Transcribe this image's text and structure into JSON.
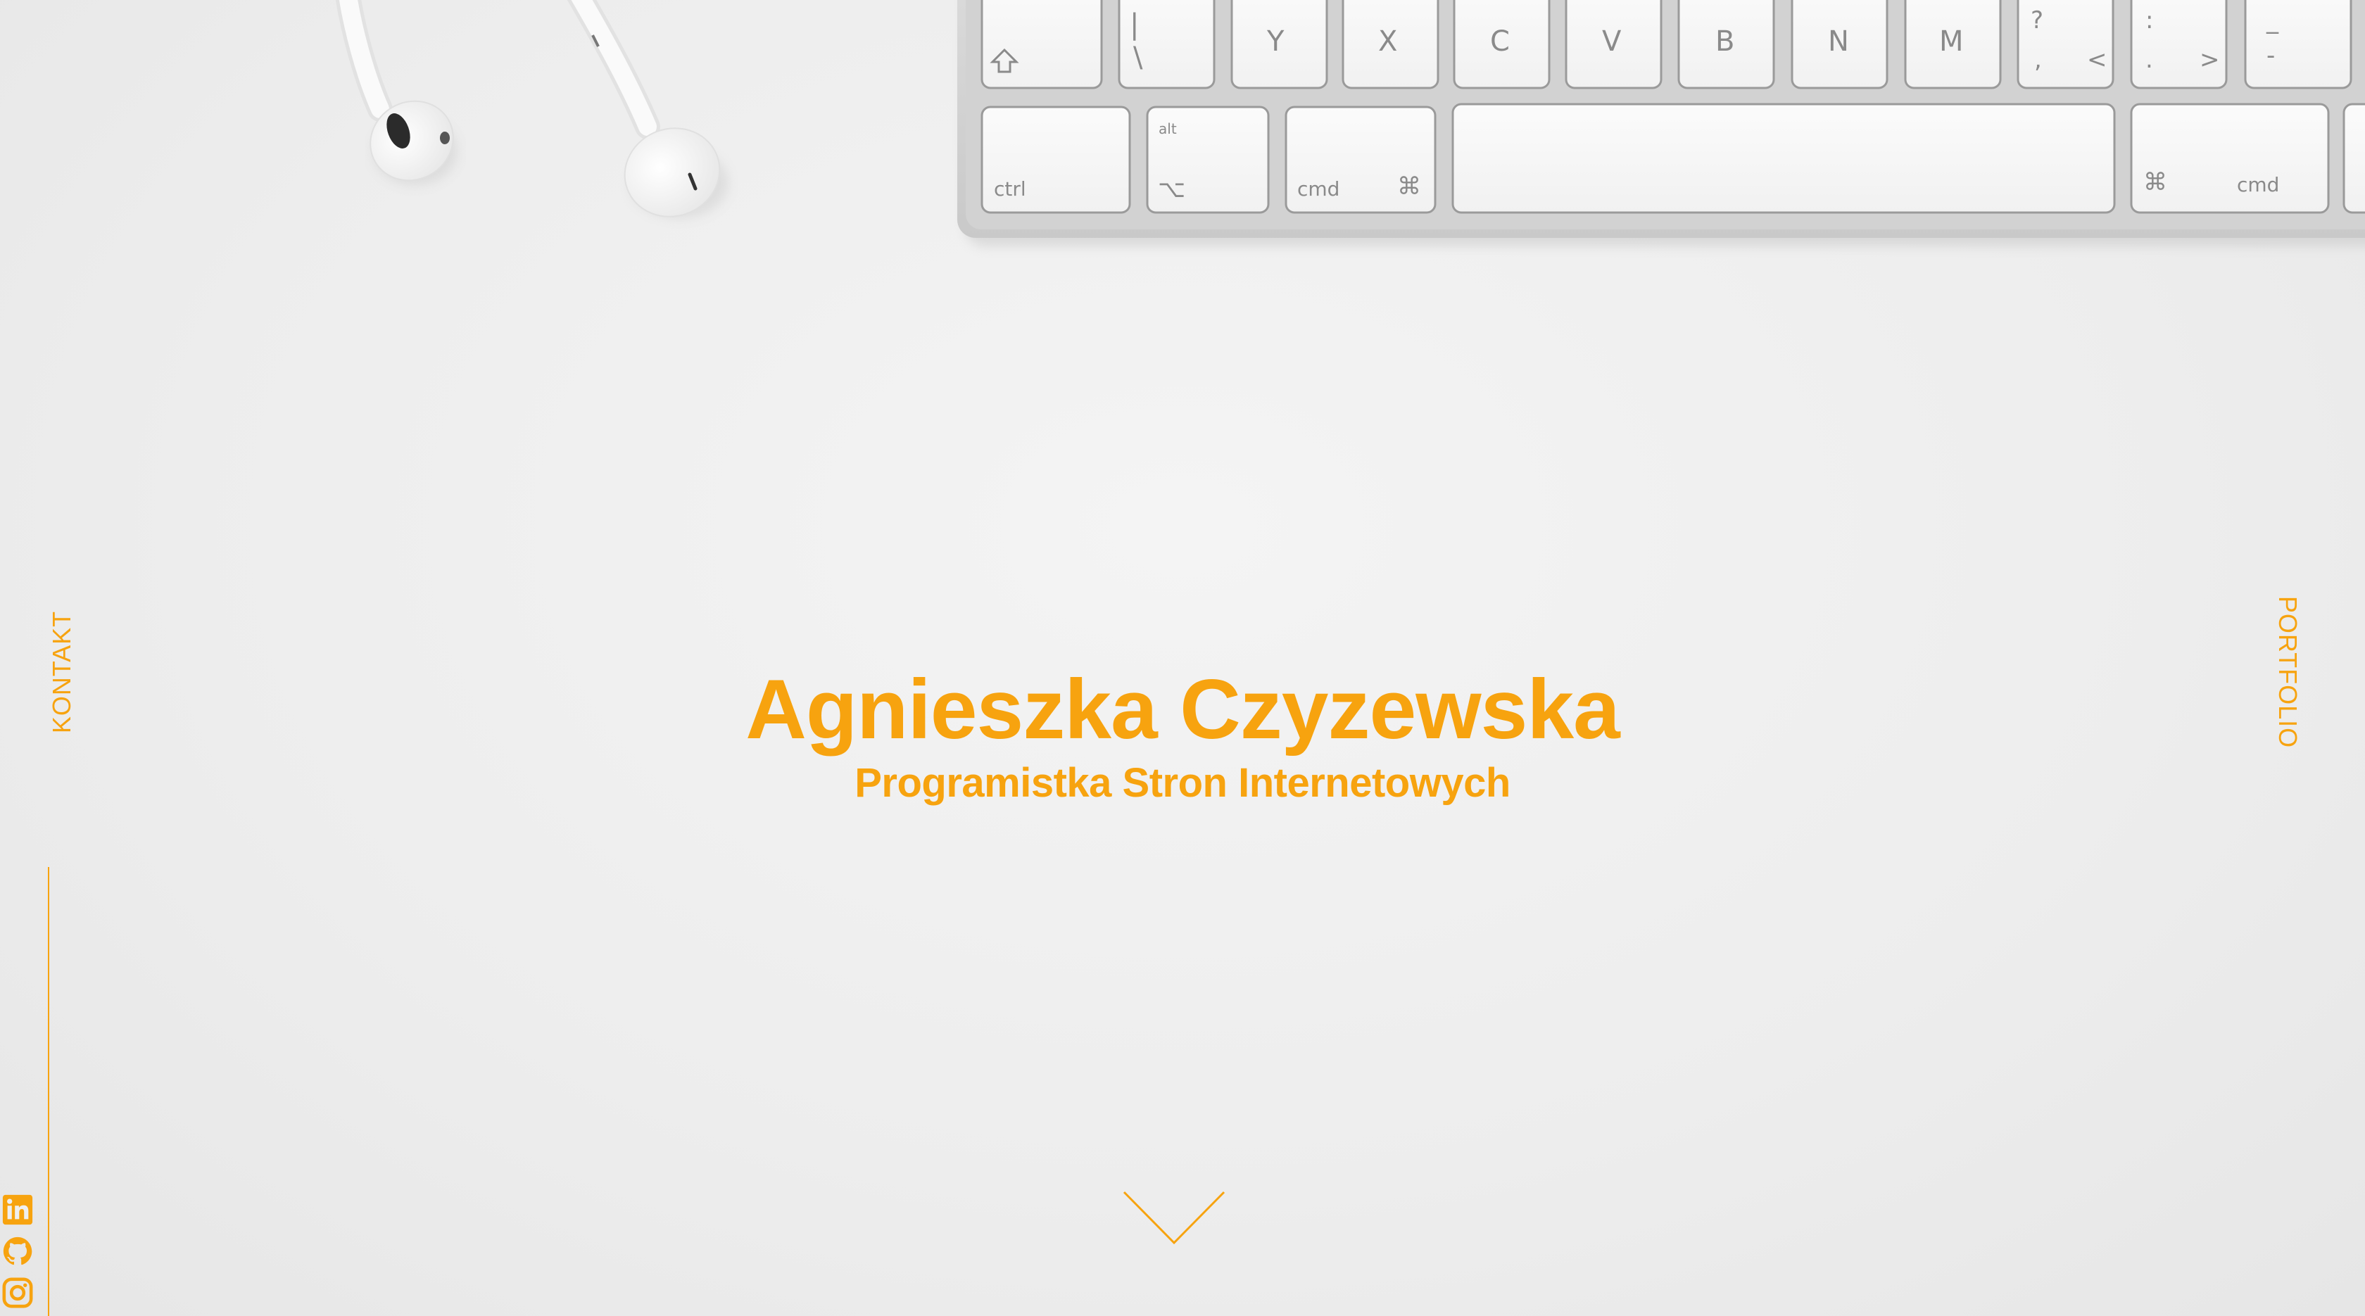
{
  "hero": {
    "name": "Agnieszka Czyzewska",
    "subtitle": "Programistka Stron Internetowych"
  },
  "nav": {
    "left_link": "KONTAKT",
    "right_link": "PORTFOLIO"
  },
  "social": [
    {
      "icon": "linkedin-icon"
    },
    {
      "icon": "github-icon"
    },
    {
      "icon": "instagram-icon"
    }
  ],
  "keyboard": {
    "row1": [
      "",
      "|\\",
      "Y",
      "X",
      "C",
      "V",
      "B",
      "N",
      "M",
      "?,<",
      ":.>",
      "_-"
    ],
    "row2": [
      "ctrl",
      "alt",
      "cmd",
      "",
      "cmd"
    ]
  },
  "colors": {
    "accent": "#f7a30f",
    "background": "#efefef"
  }
}
